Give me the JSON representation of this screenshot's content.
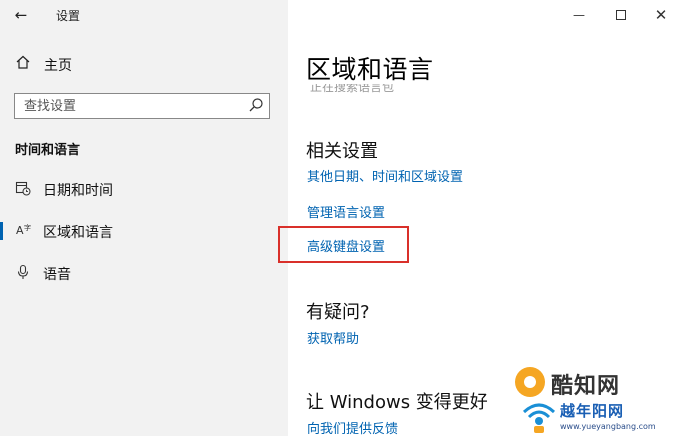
{
  "app_title": "设置",
  "sidebar": {
    "home_label": "主页",
    "search_placeholder": "查找设置",
    "section_heading": "时间和语言",
    "items": [
      {
        "label": "日期和时间",
        "icon": "calendar-clock-icon"
      },
      {
        "label": "区域和语言",
        "icon": "region-language-icon",
        "active": true
      },
      {
        "label": "语音",
        "icon": "microphone-icon"
      }
    ]
  },
  "main": {
    "page_title": "区域和语言",
    "faded_text": "正在搜索语言包",
    "related": {
      "heading": "相关设置",
      "links": [
        "其他日期、时间和区域设置",
        "管理语言设置",
        "高级键盘设置"
      ],
      "highlighted_index": 2
    },
    "question": {
      "heading": "有疑问?",
      "link": "获取帮助"
    },
    "better": {
      "heading": "让 Windows 变得更好",
      "link": "向我们提供反馈"
    }
  },
  "watermark": {
    "site_name": "酷知网",
    "brand": "越年阳网",
    "url": "www.yueyangbang.com"
  },
  "colors": {
    "accent": "#0063b1",
    "highlight_border": "#d9302a",
    "sidebar_bg": "#f2f2f2"
  }
}
